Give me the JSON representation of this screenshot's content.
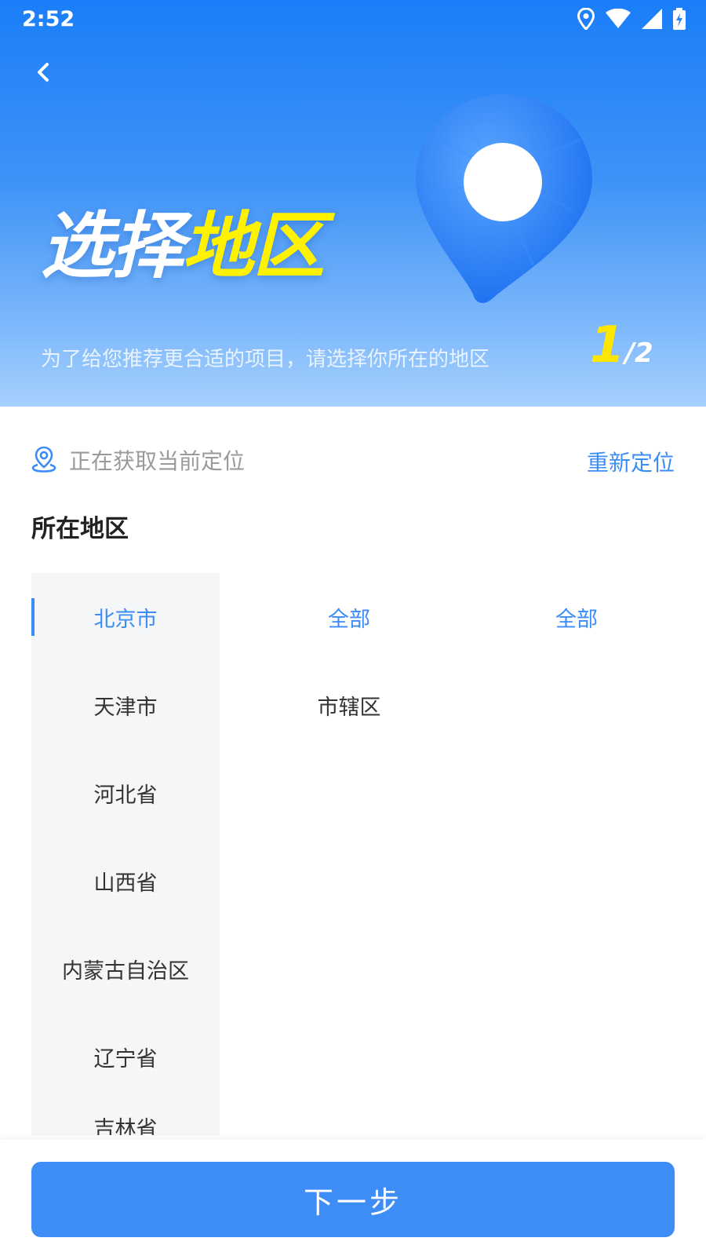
{
  "status_bar": {
    "time": "2:52",
    "icons": [
      "location-icon",
      "wifi-icon",
      "signal-icon",
      "battery-charging-icon"
    ]
  },
  "hero": {
    "title_white": "选择",
    "title_yellow": "地区",
    "subtitle": "为了给您推荐更合适的项目，请选择你所在的地区",
    "step_current": "1",
    "step_total": "/2",
    "colors": {
      "accent_yellow": "#fff200",
      "gradient_top": "#1a7ef8",
      "gradient_bottom": "#a6d0fd"
    }
  },
  "location": {
    "status_text": "正在获取当前定位",
    "relocate_label": "重新定位"
  },
  "section": {
    "title": "所在地区"
  },
  "provinces": [
    {
      "label": "北京市",
      "active": true
    },
    {
      "label": "天津市",
      "active": false
    },
    {
      "label": "河北省",
      "active": false
    },
    {
      "label": "山西省",
      "active": false
    },
    {
      "label": "内蒙古自治区",
      "active": false
    },
    {
      "label": "辽宁省",
      "active": false
    },
    {
      "label": "吉林省",
      "active": false
    }
  ],
  "cities": [
    {
      "label": "全部",
      "active": true
    },
    {
      "label": "市辖区",
      "active": false
    }
  ],
  "districts": [
    {
      "label": "全部",
      "active": true
    }
  ],
  "footer": {
    "next_label": "下一步"
  },
  "theme": {
    "primary": "#3e8cf6",
    "sidebar_bg": "#f5f6f8"
  }
}
